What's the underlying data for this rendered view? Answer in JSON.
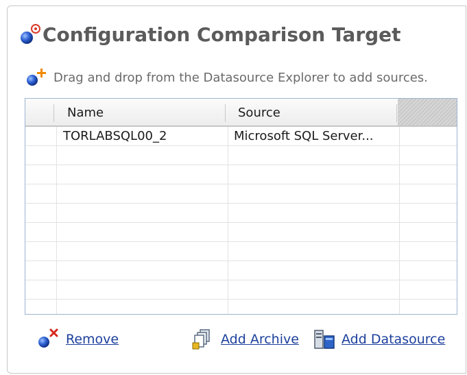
{
  "panel": {
    "title": "Configuration Comparison Target",
    "hint": "Drag and drop from the Datasource Explorer to add sources."
  },
  "grid": {
    "columns": [
      "Name",
      "Source"
    ],
    "rows": [
      {
        "name": "TORLABSQL00_2",
        "source": "Microsoft SQL Server..."
      },
      {
        "name": "",
        "source": ""
      },
      {
        "name": "",
        "source": ""
      },
      {
        "name": "",
        "source": ""
      },
      {
        "name": "",
        "source": ""
      },
      {
        "name": "",
        "source": ""
      },
      {
        "name": "",
        "source": ""
      },
      {
        "name": "",
        "source": ""
      },
      {
        "name": "",
        "source": ""
      }
    ]
  },
  "actions": {
    "remove": "Remove",
    "add_archive": "Add Archive",
    "add_datasource": "Add Datasource"
  },
  "icons": {
    "title": "datasource-target-icon",
    "hint": "add-source-icon",
    "remove": "remove-icon",
    "add_archive": "archive-icon",
    "add_datasource": "datasource-icon"
  },
  "colors": {
    "link": "#1c3f9c",
    "title": "#5b5b5b",
    "grid_border": "#9cb3cf"
  }
}
